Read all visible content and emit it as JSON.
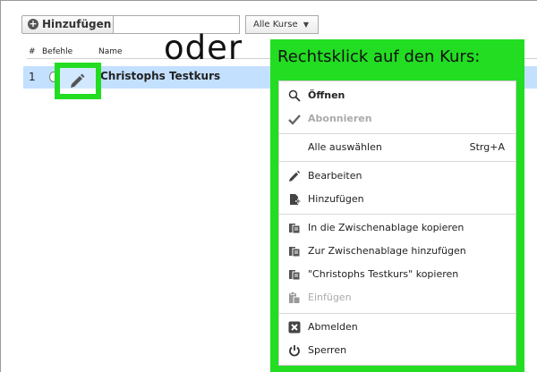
{
  "toolbar": {
    "add_label": "Hinzufügen",
    "course_filter": "Alle Kurse"
  },
  "grid": {
    "headers": {
      "num": "#",
      "commands": "Befehle",
      "name": "Name"
    },
    "row": {
      "num": "1",
      "name": "Christophs Testkurs"
    }
  },
  "annotation": {
    "or": "oder",
    "callout": "Rechtsklick auf den Kurs:"
  },
  "context_menu": {
    "items": [
      {
        "label": "Öffnen",
        "icon": "search-icon"
      },
      {
        "label": "Abonnieren",
        "icon": "check-icon"
      },
      {
        "label": "Alle auswählen",
        "shortcut": "Strg+A"
      },
      {
        "label": "Bearbeiten",
        "icon": "pencil-icon"
      },
      {
        "label": "Hinzufügen",
        "icon": "add-file-icon"
      },
      {
        "label": "In die Zwischenablage kopieren",
        "icon": "clipboard-icon"
      },
      {
        "label": "Zur Zwischenablage hinzufügen",
        "icon": "clipboard-icon"
      },
      {
        "label": "\"Christophs Testkurs\" kopieren",
        "icon": "clipboard-icon"
      },
      {
        "label": "Einfügen",
        "icon": "paste-icon"
      },
      {
        "label": "Abmelden",
        "icon": "remove-square-icon"
      },
      {
        "label": "Sperren",
        "icon": "power-icon"
      }
    ]
  },
  "colors": {
    "highlight_green": "#22dd22",
    "selected_row": "#c3e0ff"
  }
}
